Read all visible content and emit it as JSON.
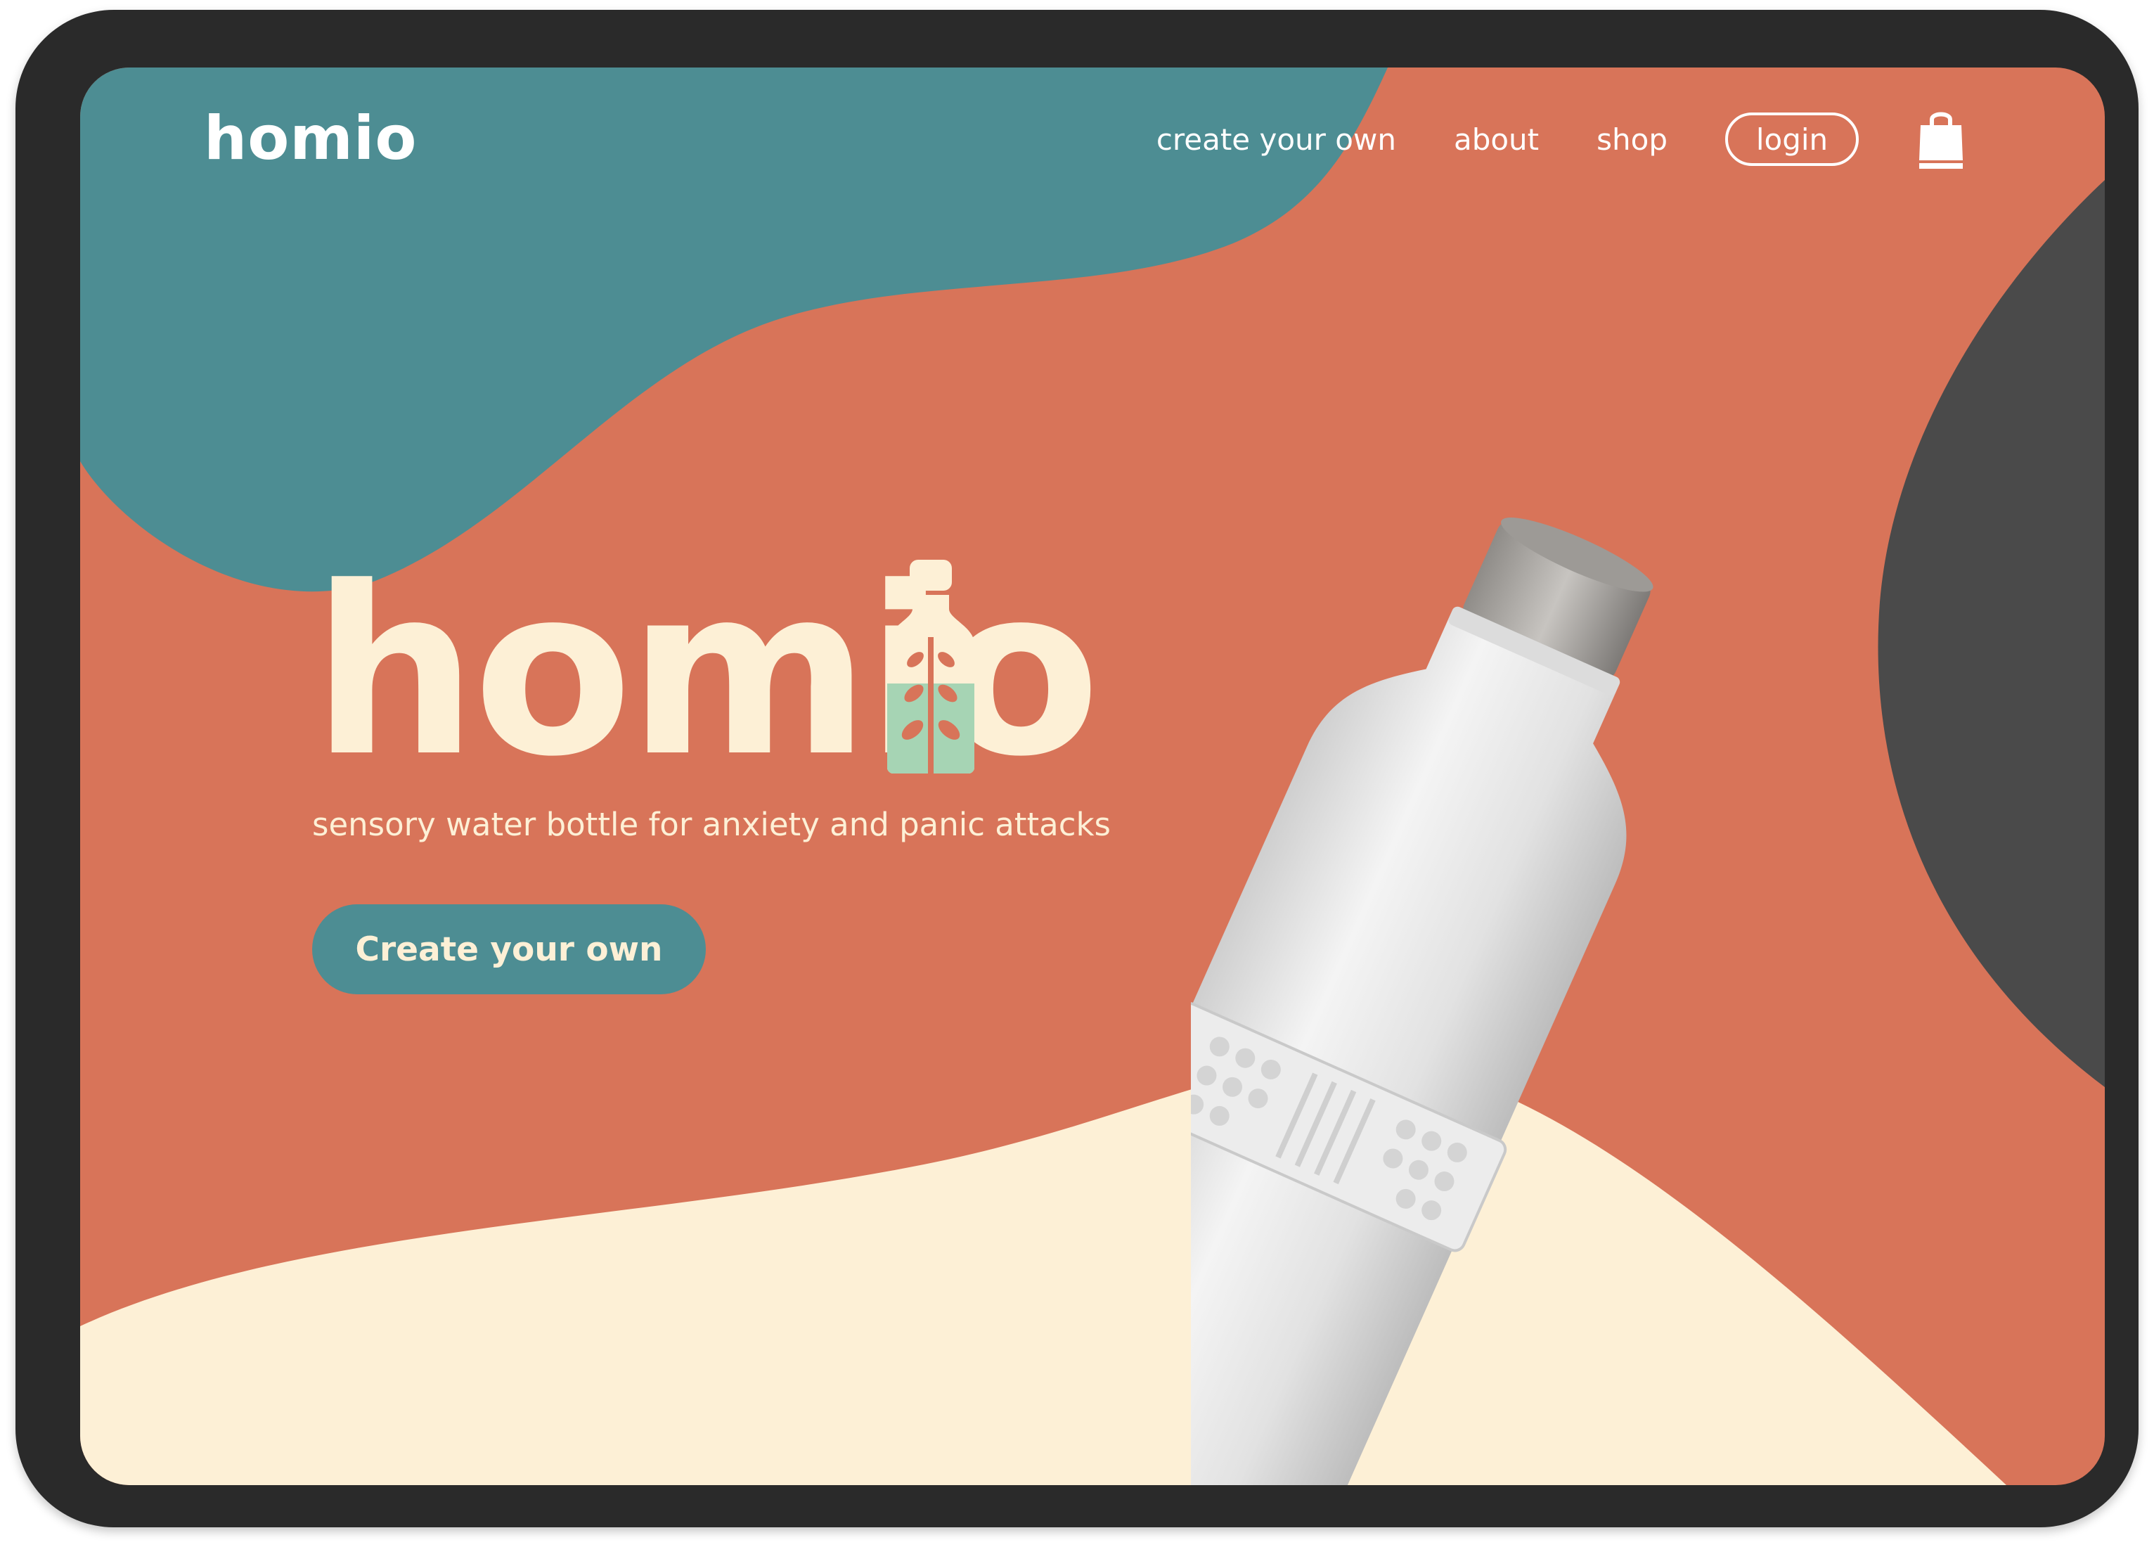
{
  "brand": {
    "name": "homio"
  },
  "nav": {
    "links": [
      {
        "label": "create your own"
      },
      {
        "label": "about"
      },
      {
        "label": "shop"
      }
    ],
    "login_label": "login",
    "cart_icon": "shopping-bag-icon"
  },
  "hero": {
    "wordmark": "homio",
    "subtitle": "sensory water bottle for anxiety and panic attacks",
    "cta_label": "Create your own"
  },
  "colors": {
    "background": "#d87459",
    "teal": "#4d8d93",
    "cream": "#fdf0d6",
    "charcoal": "#4a4a4a",
    "mint": "#a6d4b4",
    "white": "#ffffff"
  }
}
